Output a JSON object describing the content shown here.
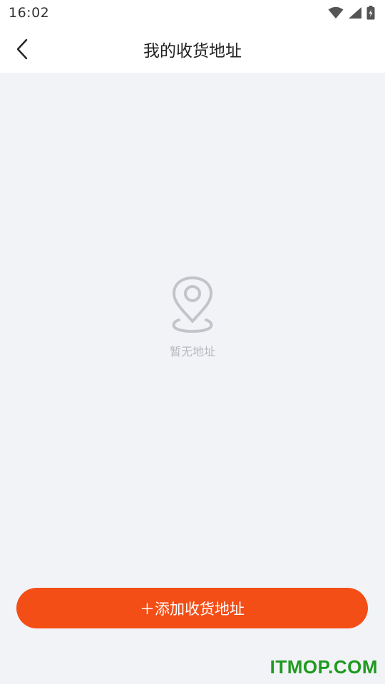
{
  "status_bar": {
    "time": "16:02",
    "icons": [
      "wifi-icon",
      "signal-icon",
      "battery-charging-icon"
    ]
  },
  "nav": {
    "back_icon": "chevron-left-icon",
    "title": "我的收货地址"
  },
  "empty_state": {
    "icon": "location-pin-icon",
    "text": "暂无地址"
  },
  "footer": {
    "add_button_label": "＋添加收货地址"
  },
  "watermark": "ITMOP.COM",
  "colors": {
    "accent": "#F44E17",
    "background": "#F2F3F7",
    "placeholder": "#B7B9BF",
    "watermark": "#1E9A1E"
  }
}
